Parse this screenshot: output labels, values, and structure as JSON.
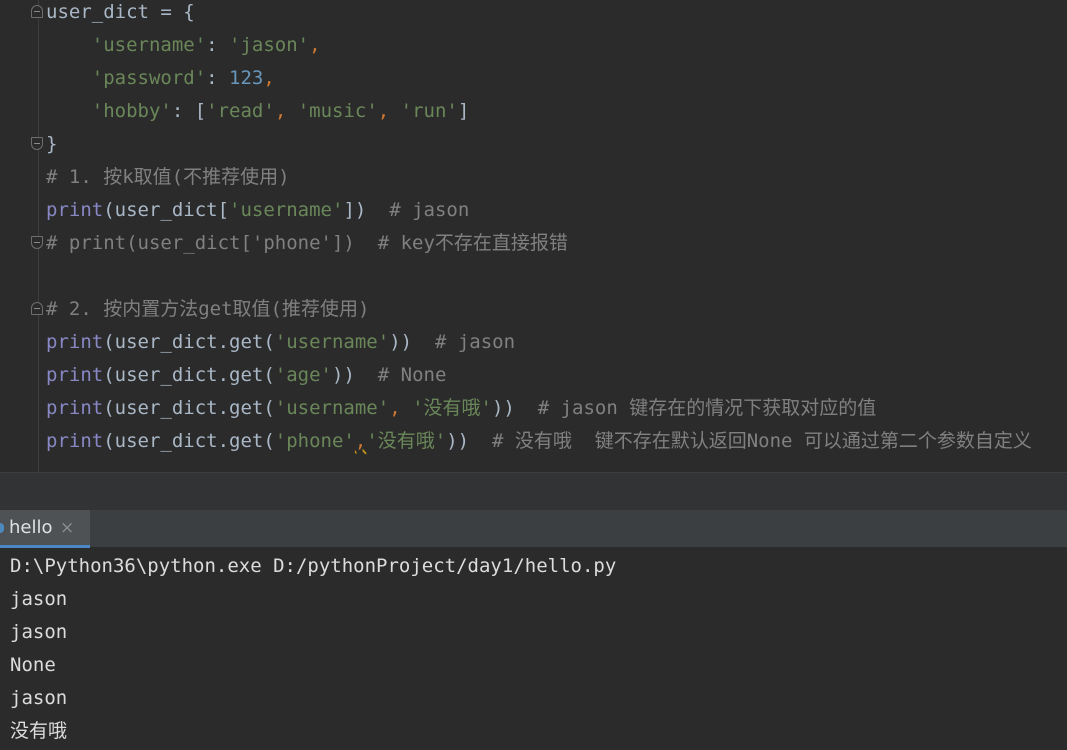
{
  "editor": {
    "lines": [
      {
        "parts": [
          {
            "t": "user_dict = {",
            "c": ""
          }
        ]
      },
      {
        "parts": [
          {
            "t": "    ",
            "c": ""
          },
          {
            "t": "'username'",
            "c": "str"
          },
          {
            "t": ": ",
            "c": ""
          },
          {
            "t": "'jason'",
            "c": "str"
          },
          {
            "t": ",",
            "c": "op"
          }
        ]
      },
      {
        "parts": [
          {
            "t": "    ",
            "c": ""
          },
          {
            "t": "'password'",
            "c": "str"
          },
          {
            "t": ": ",
            "c": ""
          },
          {
            "t": "123",
            "c": "num"
          },
          {
            "t": ",",
            "c": "op"
          }
        ]
      },
      {
        "parts": [
          {
            "t": "    ",
            "c": ""
          },
          {
            "t": "'hobby'",
            "c": "str"
          },
          {
            "t": ": [",
            "c": ""
          },
          {
            "t": "'read'",
            "c": "str"
          },
          {
            "t": ", ",
            "c": "op"
          },
          {
            "t": "'music'",
            "c": "str"
          },
          {
            "t": ", ",
            "c": "op"
          },
          {
            "t": "'run'",
            "c": "str"
          },
          {
            "t": "]",
            "c": ""
          }
        ]
      },
      {
        "parts": [
          {
            "t": "}",
            "c": ""
          }
        ]
      },
      {
        "parts": [
          {
            "t": "# 1. 按k取值(不推荐使用)",
            "c": "cm"
          }
        ]
      },
      {
        "parts": [
          {
            "t": "print",
            "c": "kw"
          },
          {
            "t": "(user_dict[",
            "c": ""
          },
          {
            "t": "'username'",
            "c": "str"
          },
          {
            "t": "])  ",
            "c": ""
          },
          {
            "t": "# jason",
            "c": "cm"
          }
        ]
      },
      {
        "parts": [
          {
            "t": "# print(user_dict['phone'])  # key不存在直接报错",
            "c": "cm"
          }
        ]
      },
      {
        "parts": []
      },
      {
        "parts": [
          {
            "t": "# 2. 按内置方法get取值(推荐使用)",
            "c": "cm"
          }
        ]
      },
      {
        "parts": [
          {
            "t": "print",
            "c": "kw"
          },
          {
            "t": "(user_dict.get(",
            "c": ""
          },
          {
            "t": "'username'",
            "c": "str"
          },
          {
            "t": "))  ",
            "c": ""
          },
          {
            "t": "# jason",
            "c": "cm"
          }
        ]
      },
      {
        "parts": [
          {
            "t": "print",
            "c": "kw"
          },
          {
            "t": "(user_dict.get(",
            "c": ""
          },
          {
            "t": "'age'",
            "c": "str"
          },
          {
            "t": "))  ",
            "c": ""
          },
          {
            "t": "# None",
            "c": "cm"
          }
        ]
      },
      {
        "parts": [
          {
            "t": "print",
            "c": "kw"
          },
          {
            "t": "(user_dict.get(",
            "c": ""
          },
          {
            "t": "'username'",
            "c": "str"
          },
          {
            "t": ", ",
            "c": "op"
          },
          {
            "t": "'没有哦'",
            "c": "str"
          },
          {
            "t": "))  ",
            "c": ""
          },
          {
            "t": "# jason 键存在的情况下获取对应的值",
            "c": "cm"
          }
        ]
      },
      {
        "parts": [
          {
            "t": "print",
            "c": "kw"
          },
          {
            "t": "(user_dict.get(",
            "c": ""
          },
          {
            "t": "'phone'",
            "c": "str"
          },
          {
            "t": ",",
            "c": "squiggle"
          },
          {
            "t": "'没有哦'",
            "c": "str"
          },
          {
            "t": "))  ",
            "c": ""
          },
          {
            "t": "# 没有哦  键不存在默认返回None 可以通过第二个参数自定义",
            "c": "cm"
          }
        ]
      }
    ]
  },
  "run_panel": {
    "tab_label": "hello",
    "tab_close_glyph": "×",
    "output": [
      "D:\\Python36\\python.exe D:/pythonProject/day1/hello.py",
      "jason",
      "jason",
      "None",
      "jason",
      "没有哦"
    ]
  },
  "colors": {
    "editor_bg": "#2b2b2b",
    "keyword": "#8888c6",
    "string": "#6a8759",
    "number": "#6897bb",
    "comment": "#808080",
    "punctuation": "#cc7832",
    "tab_accent": "#4a88c7"
  }
}
